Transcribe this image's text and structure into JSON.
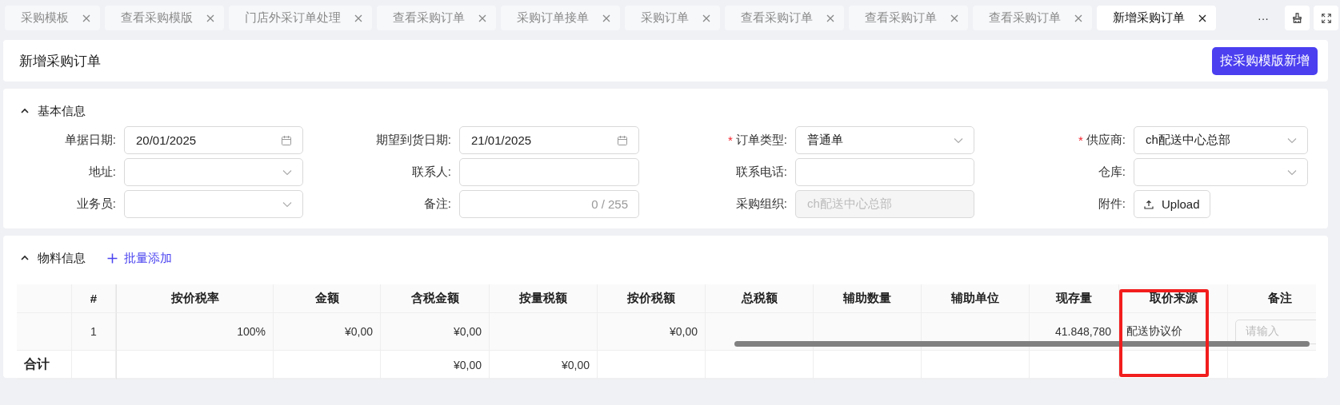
{
  "tabs": [
    {
      "label": "采购模板",
      "selected": false
    },
    {
      "label": "查看采购模版",
      "selected": false
    },
    {
      "label": "门店外采订单处理",
      "selected": false
    },
    {
      "label": "查看采购订单",
      "selected": false
    },
    {
      "label": "采购订单接单",
      "selected": false
    },
    {
      "label": "采购订单",
      "selected": false
    },
    {
      "label": "查看采购订单",
      "selected": false
    },
    {
      "label": "查看采购订单",
      "selected": false
    },
    {
      "label": "查看采购订单",
      "selected": false
    },
    {
      "label": "新增采购订单",
      "selected": true
    }
  ],
  "tab_more": "···",
  "required_mark": "*",
  "page_header": {
    "title": "新增采购订单",
    "button": "按采购模版新增"
  },
  "basic_info": {
    "title": "基本信息",
    "expanded": true,
    "fields": [
      {
        "label": "单据日期:",
        "kind": "date",
        "required": false,
        "value": "20/01/2025"
      },
      {
        "label": "期望到货日期:",
        "kind": "date",
        "required": false,
        "value": "21/01/2025"
      },
      {
        "label": "订单类型:",
        "kind": "select",
        "required": true,
        "value": "普通单"
      },
      {
        "label": "供应商:",
        "kind": "select",
        "required": true,
        "value": "ch配送中心总部"
      },
      {
        "label": "地址:",
        "kind": "select",
        "required": false
      },
      {
        "label": "联系人:",
        "kind": "text",
        "required": false
      },
      {
        "label": "联系电话:",
        "kind": "text",
        "required": false
      },
      {
        "label": "仓库:",
        "kind": "select",
        "required": false
      },
      {
        "label": "业务员:",
        "kind": "select",
        "required": false
      },
      {
        "label": "备注:",
        "kind": "textarea",
        "required": false,
        "counter": "0 / 255"
      },
      {
        "label": "采购组织:",
        "kind": "text",
        "required": false,
        "disabled": true,
        "value": "ch配送中心总部"
      },
      {
        "label": "附件:",
        "kind": "upload",
        "required": false,
        "button": "Upload"
      }
    ]
  },
  "material_info": {
    "title": "物料信息",
    "expanded": true,
    "add_button": "批量添加",
    "table": {
      "total_label": "合计",
      "columns": [
        {
          "label": "#",
          "kind": "index",
          "highlighted": false,
          "cell": "1"
        },
        {
          "label": "按价税率",
          "kind": "number",
          "highlighted": false,
          "cell": "100%"
        },
        {
          "label": "金额",
          "kind": "number",
          "highlighted": false,
          "cell": "¥0,00"
        },
        {
          "label": "含税金额",
          "kind": "number",
          "highlighted": false,
          "cell": "¥0,00",
          "total": "¥0,00"
        },
        {
          "label": "按量税额",
          "kind": "number",
          "highlighted": false,
          "total": "¥0,00"
        },
        {
          "label": "按价税额",
          "kind": "number",
          "highlighted": false,
          "cell": "¥0,00"
        },
        {
          "label": "总税额",
          "kind": "number",
          "highlighted": false
        },
        {
          "label": "辅助数量",
          "kind": "number",
          "highlighted": false
        },
        {
          "label": "辅助单位",
          "kind": "number",
          "highlighted": false
        },
        {
          "label": "现存量",
          "kind": "number",
          "highlighted": false,
          "cell": "41.848,780"
        },
        {
          "label": "取价来源",
          "kind": "text",
          "highlighted": true,
          "cell": "配送协议价"
        },
        {
          "label": "备注",
          "kind": "input",
          "highlighted": false,
          "cell_placeholder": "请输入"
        }
      ]
    }
  }
}
